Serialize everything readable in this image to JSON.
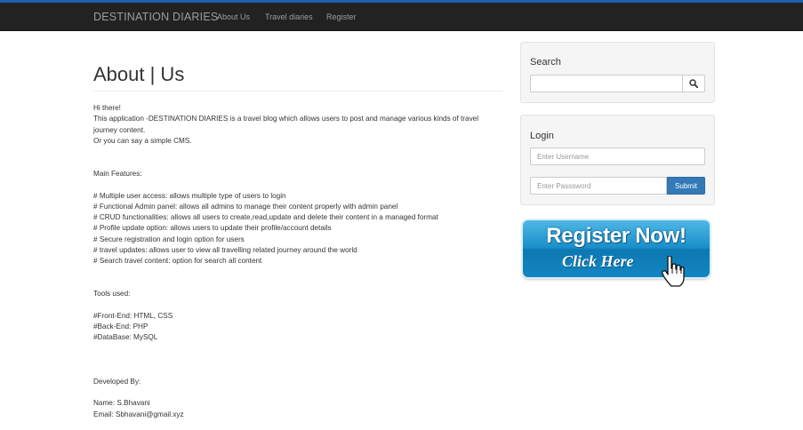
{
  "navbar": {
    "brand": "DESTINATION DIARIES",
    "links": [
      "About Us",
      "Travel diaries",
      "Register"
    ]
  },
  "main": {
    "title": "About | Us",
    "content": "Hi there!\nThis application -DESTINATION DIARIES is a travel blog which allows users to post and manage various kinds of travel journey content.\nOr you can say a simple CMS.\n\n\nMain Features:\n\n# Multiple user access: allows multiple type of users to login\n# Functional Admin panel: allows all admins to manage their content properly with admin panel\n# CRUD functionalities: allows all users to create,read,update and delete their content in a managed format\n# Profile update option: allows users to update their profile/account details\n# Secure registration and login option for users\n# travel updates: allows user to view all travelling related journey around the world\n# Search travel content: option for search all content\n\n\nTools used:\n\n#Front-End: HTML, CSS\n#Back-End: PHP\n#DataBase: MySQL\n\n\n\nDeveloped By:\n\nName: S.Bhavani\nEmail: Sbhavani@gmail.xyz"
  },
  "search": {
    "heading": "Search",
    "value": "",
    "button_icon": "search-icon"
  },
  "login": {
    "heading": "Login",
    "username_placeholder": "Enter Username",
    "password_placeholder": "Enter Passsword",
    "submit_label": "Submit"
  },
  "register_banner": {
    "line1": "Register Now!",
    "line2": "Click Here",
    "icon": "pointer-hand-icon"
  },
  "colors": {
    "navbar": "#222222",
    "accent_line": "#1d5fa8",
    "submit": "#337ab7",
    "widget_bg": "#f5f5f5"
  }
}
